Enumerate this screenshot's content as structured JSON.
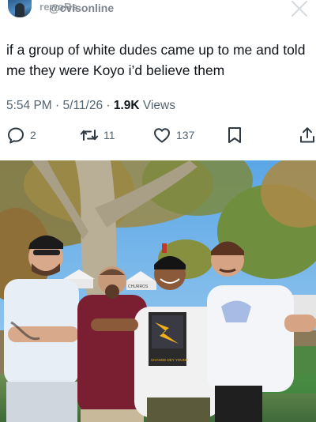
{
  "header": {
    "handle_ghost": "rewoRs",
    "handle": "@cvisonline"
  },
  "tweet": {
    "text": "if a group of white dudes came up to me and told me they were Koyo i’d believe them",
    "time": "5:54 PM",
    "date": "5/11/26",
    "separator": " · ",
    "views_count": "1.9K",
    "views_label": " Views"
  },
  "actions": {
    "reply_count": "2",
    "retweet_count": "11",
    "like_count": "137"
  },
  "photo": {
    "shirt_text": "CHANGE DEY YOUNG",
    "tent_text": "CHURROS"
  },
  "colors": {
    "text": "#0f1419",
    "muted": "#536471",
    "background": "#ffffff"
  },
  "icons": [
    "close-icon",
    "reply-icon",
    "retweet-icon",
    "like-icon",
    "bookmark-icon",
    "share-icon"
  ]
}
